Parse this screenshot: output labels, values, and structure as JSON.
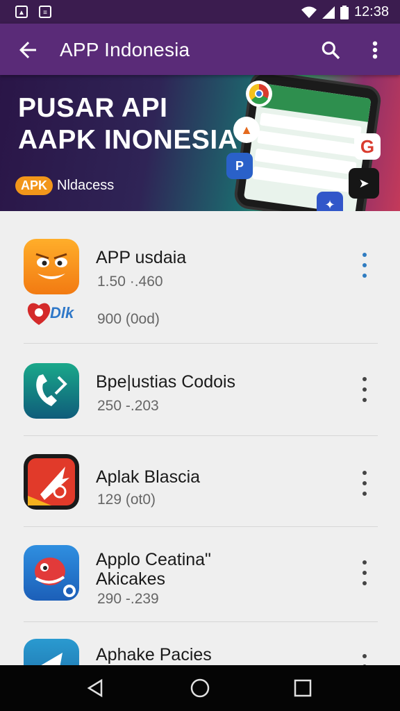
{
  "status_bar": {
    "time": "12:38"
  },
  "app_bar": {
    "title": "APP Indonesia"
  },
  "banner": {
    "headline_1": "PUSAR API",
    "headline_2": "AAPK INONESIA",
    "badge": "APK",
    "badge_text": "Nldacess"
  },
  "apps": [
    {
      "name": "APP usdaia",
      "meta": "1.50 ·.460",
      "extra_meta": "900 (0od)",
      "extra_icon_text": "Dlk"
    },
    {
      "name": "Bpe|ustias Codois",
      "meta": "250 -.203"
    },
    {
      "name": "Aplak Blascia",
      "meta": "129 (ot0)"
    },
    {
      "name_line_1": "Applo Ceatina\"",
      "name_line_2": "Akicakes",
      "meta": "290 -.239"
    },
    {
      "name": "Aphake Pacies"
    }
  ],
  "colors": {
    "status_bar": "#3b1c4f",
    "app_bar": "#5a2b78",
    "nav_bar": "#050505"
  },
  "icons": [
    "back-arrow-icon",
    "search-icon",
    "more-vert-icon",
    "wifi-icon",
    "signal-icon",
    "battery-icon",
    "nav-back-icon",
    "nav-home-icon",
    "nav-recents-icon"
  ]
}
